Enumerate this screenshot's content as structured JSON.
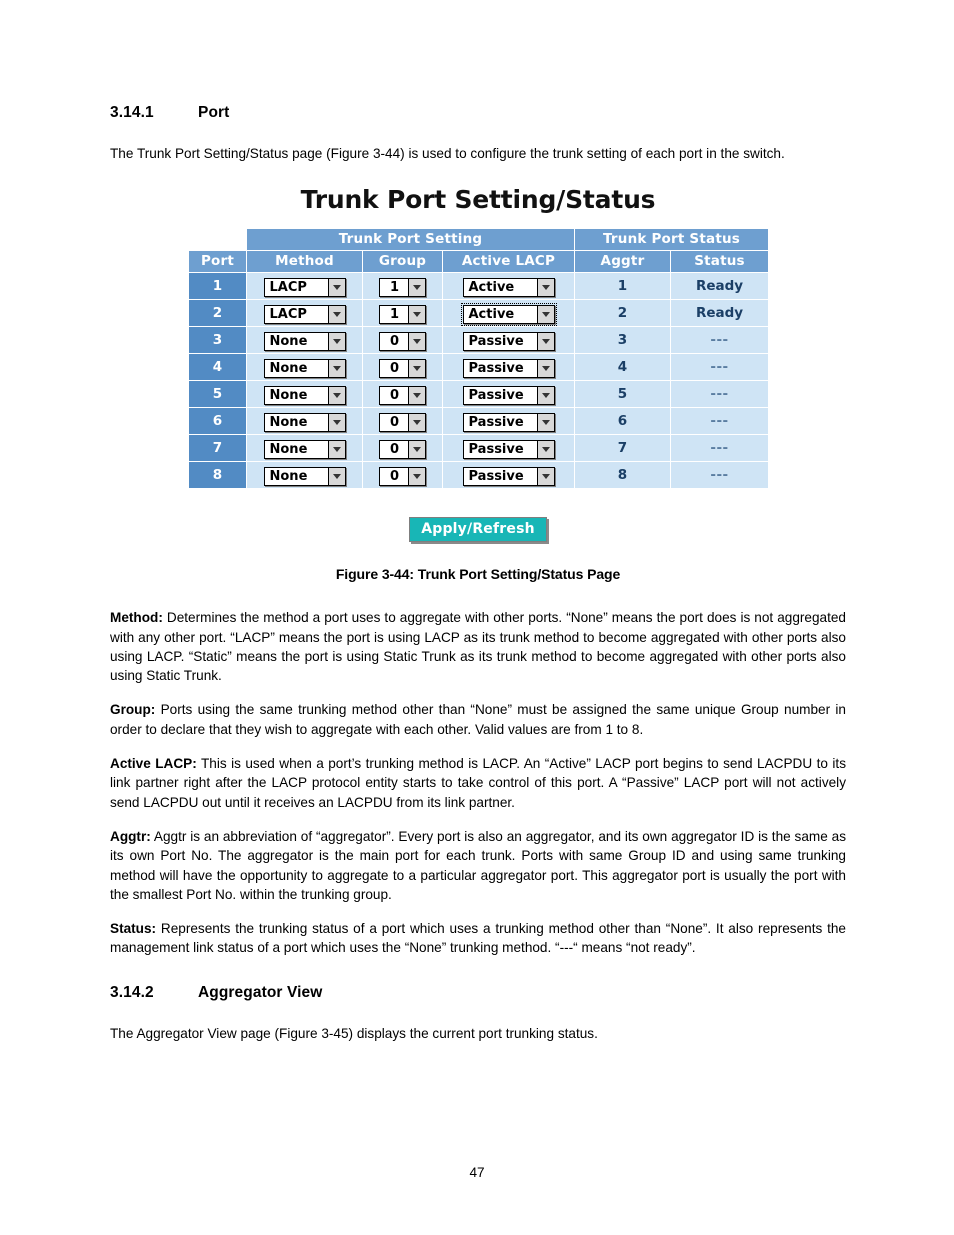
{
  "document": {
    "page_number": "47"
  },
  "sections": {
    "port": {
      "number": "3.14.1",
      "title": "Port",
      "intro": "The Trunk Port Setting/Status page (Figure 3-44) is used to configure the trunk setting of each port in the switch."
    },
    "aggregator_view": {
      "number": "3.14.2",
      "title": "Aggregator View",
      "intro": "The Aggregator View page (Figure 3-45) displays the current port trunking status."
    }
  },
  "figure": {
    "caption": "Figure 3-44: Trunk Port Setting/Status Page",
    "screenshot": {
      "title": "Trunk Port Setting/Status",
      "group_headers": {
        "setting": "Trunk Port Setting",
        "status": "Trunk Port Status"
      },
      "columns": {
        "port": "Port",
        "method": "Method",
        "group": "Group",
        "active_lacp": "Active LACP",
        "aggtr": "Aggtr",
        "status": "Status"
      },
      "rows": [
        {
          "port": "1",
          "method": "LACP",
          "group": "1",
          "active_lacp": "Active",
          "aggtr": "1",
          "status": "Ready",
          "focused": true
        },
        {
          "port": "2",
          "method": "LACP",
          "group": "1",
          "active_lacp": "Active",
          "aggtr": "2",
          "status": "Ready",
          "focused": true
        },
        {
          "port": "3",
          "method": "None",
          "group": "0",
          "active_lacp": "Passive",
          "aggtr": "3",
          "status": "---",
          "focused": false
        },
        {
          "port": "4",
          "method": "None",
          "group": "0",
          "active_lacp": "Passive",
          "aggtr": "4",
          "status": "---",
          "focused": false
        },
        {
          "port": "5",
          "method": "None",
          "group": "0",
          "active_lacp": "Passive",
          "aggtr": "5",
          "status": "---",
          "focused": false
        },
        {
          "port": "6",
          "method": "None",
          "group": "0",
          "active_lacp": "Passive",
          "aggtr": "6",
          "status": "---",
          "focused": false
        },
        {
          "port": "7",
          "method": "None",
          "group": "0",
          "active_lacp": "Passive",
          "aggtr": "7",
          "status": "---",
          "focused": false
        },
        {
          "port": "8",
          "method": "None",
          "group": "0",
          "active_lacp": "Passive",
          "aggtr": "8",
          "status": "---",
          "focused": false
        }
      ],
      "apply_button": "Apply/Refresh",
      "colors": {
        "header_blue": "#6e9fd0",
        "port_blue": "#528bc4",
        "row_blue": "#cfe4f5",
        "button_teal": "#18b6b6"
      }
    }
  },
  "definitions": [
    {
      "term": "Method:",
      "text": " Determines the method a port uses to aggregate with other ports. “None” means the port does is not aggregated with any other port. “LACP” means the port is using LACP as its trunk method to become aggregated with other ports also using LACP. “Static” means the port is using Static Trunk as its trunk method to become aggregated with other ports also using Static Trunk."
    },
    {
      "term": "Group:",
      "text": " Ports using the same trunking method other than “None” must be assigned the same unique Group number in order to declare that they wish to aggregate with each other. Valid values are from 1 to 8."
    },
    {
      "term": "Active LACP:",
      "text": " This is used when a port’s trunking method is LACP. An “Active” LACP port begins to send LACPDU to its link partner right after the LACP protocol entity starts to take control of this port. A “Passive” LACP port will not actively send LACPDU out until it receives an LACPDU from its link partner."
    },
    {
      "term": "Aggtr:",
      "text": " Aggtr is an abbreviation of “aggregator”. Every port is also an aggregator, and its own aggregator ID is the same as its own Port No. The aggregator is the main port for each trunk. Ports with same Group ID and using same trunking method will have the opportunity to aggregate to a particular aggregator port. This aggregator port is usually the port with the smallest Port No. within the trunking group."
    },
    {
      "term": "Status:",
      "text": " Represents the trunking status of a port which uses a trunking method other than “None”. It also represents the management link status of a port which uses the “None” trunking method. “---“ means “not ready”."
    }
  ]
}
